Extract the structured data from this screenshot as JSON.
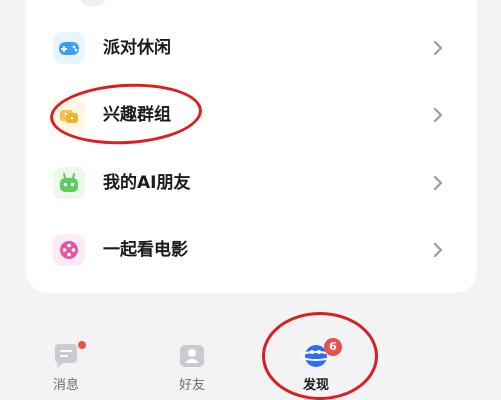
{
  "menu": {
    "items": [
      {
        "label": "派对休闲",
        "icon": "gamepad-icon",
        "color": "#3aa0f5"
      },
      {
        "label": "兴趣群组",
        "icon": "group-icon",
        "color": "#f5c34a"
      },
      {
        "label": "我的AI朋友",
        "icon": "robot-icon",
        "color": "#5ecb5e"
      },
      {
        "label": "一起看电影",
        "icon": "film-reel-icon",
        "color": "#e357a8"
      }
    ]
  },
  "tabbar": {
    "tabs": [
      {
        "label": "消息",
        "icon": "message-icon",
        "has_dot": true
      },
      {
        "label": "好友",
        "icon": "contacts-icon",
        "has_dot": false
      },
      {
        "label": "发现",
        "icon": "planet-icon",
        "active": true,
        "badge": "6"
      }
    ]
  },
  "colors": {
    "highlight_oval": "#dc1e1e",
    "badge": "#e8524a",
    "card_bg": "#ffffff",
    "page_bg": "#f3f3f5"
  }
}
